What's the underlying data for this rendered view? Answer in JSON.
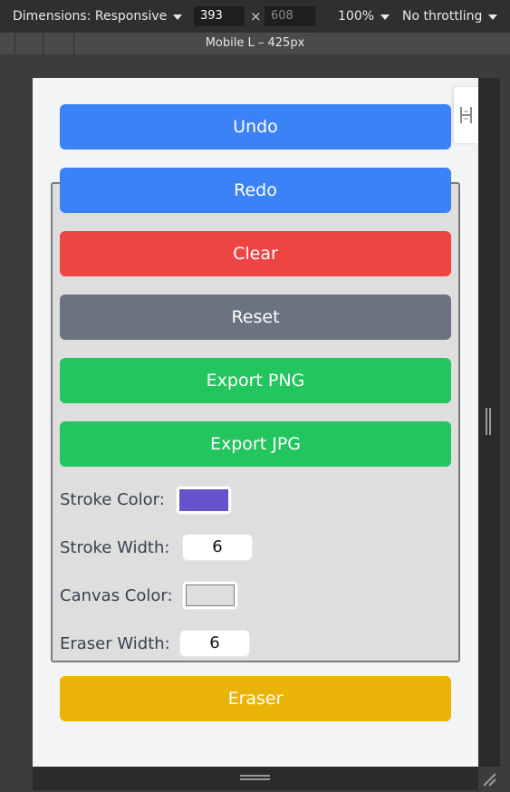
{
  "devtools": {
    "dimensions_label": "Dimensions: Responsive",
    "width_value": "393",
    "height_placeholder": "608",
    "times": "×",
    "zoom": "100%",
    "throttling": "No throttling",
    "media_query_label": "Mobile L – 425px"
  },
  "app": {
    "buttons": {
      "undo": "Undo",
      "redo": "Redo",
      "clear": "Clear",
      "reset": "Reset",
      "export_png": "Export PNG",
      "export_jpg": "Export JPG",
      "eraser": "Eraser"
    },
    "settings": {
      "stroke_color_label": "Stroke Color:",
      "stroke_color_value": "#6653cc",
      "stroke_width_label": "Stroke Width:",
      "stroke_width_value": "6",
      "canvas_color_label": "Canvas Color:",
      "canvas_color_value": "#dedede",
      "eraser_width_label": "Eraser Width:",
      "eraser_width_value": "6"
    },
    "colors": {
      "blue": "#3b82f6",
      "red": "#ef4444",
      "gray": "#6b7280",
      "green": "#22c55e",
      "amber": "#eab308"
    },
    "icons": {
      "floating_tab": "drag-handle-icon"
    }
  }
}
